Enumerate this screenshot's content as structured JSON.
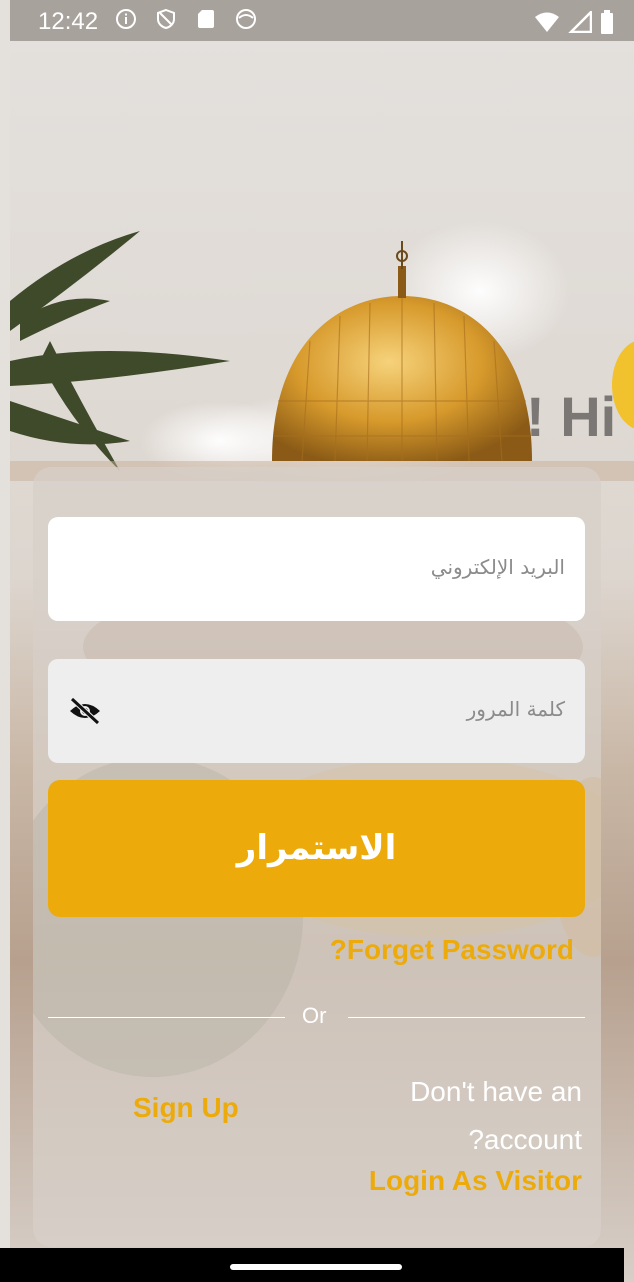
{
  "status_bar": {
    "time": "12:42",
    "icons": [
      "info-icon",
      "shield-icon",
      "sd-card-icon",
      "face-icon"
    ],
    "right_icons": [
      "wifi-icon",
      "signal-icon",
      "battery-icon"
    ]
  },
  "hero": {
    "greeting": "! Hi"
  },
  "login_form": {
    "email_placeholder": "البريد الإلكتروني",
    "password_placeholder": "كلمة المرور",
    "continue_label": "الاستمرار",
    "forget_password_label": "?Forget Password",
    "divider_label": "Or",
    "signup_label": "Sign Up",
    "no_account_line1": "Don't have an",
    "no_account_line2": "?account",
    "visitor_label": "Login As Visitor"
  },
  "colors": {
    "accent": "#ecab0b",
    "status_bar": "#a8a29d",
    "placeholder": "#8b8b8b"
  }
}
